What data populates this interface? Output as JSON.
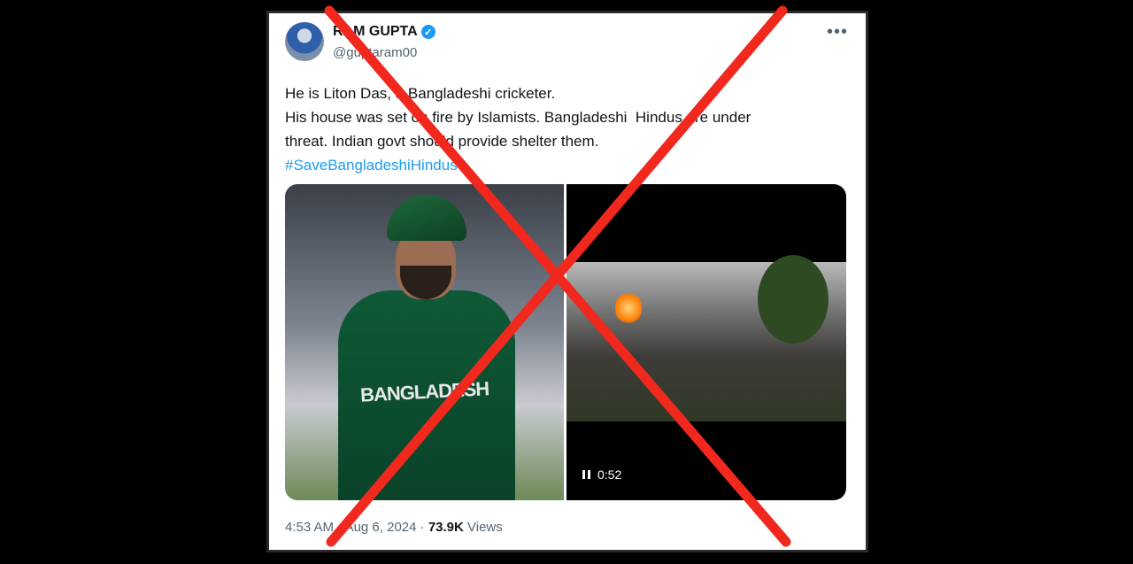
{
  "tweet": {
    "display_name": "RAM GUPTA",
    "handle": "@guptaram00",
    "more_icon": "more-horizontal-icon",
    "lines": [
      "He is Liton Das, a Bangladeshi cricketer.",
      "His house was set on fire by Islamists. Bangladeshi  Hindus are under",
      "threat. Indian govt should provide shelter them."
    ],
    "hashtag": "#SaveBangladeshiHindus",
    "media": {
      "photo_shirt_text": "BANGLADESH",
      "video_duration": "0:52"
    },
    "time": "4:53 AM",
    "separator": "·",
    "date": "Aug 6, 2024",
    "views_count": "73.9K",
    "views_label": "Views"
  },
  "overlay": {
    "color": "#f0281e",
    "icon": "red-cross-icon"
  }
}
